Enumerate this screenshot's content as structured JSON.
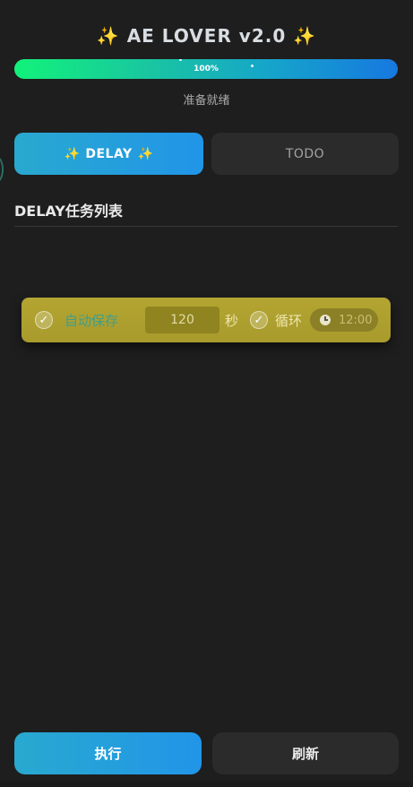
{
  "app": {
    "sparkle": "✨",
    "title": "AE LOVER v2.0"
  },
  "progress": {
    "value": 1.0,
    "label": "100%",
    "gradient": [
      "#12f27a",
      "#1678e0"
    ]
  },
  "status": {
    "text": "准备就绪"
  },
  "tabs": [
    {
      "label": "DELAY",
      "active": true
    },
    {
      "label": "TODO",
      "active": false
    }
  ],
  "section": {
    "title": "DELAY任务列表"
  },
  "task": {
    "autosave_label": "自动保存",
    "autosave_checked": true,
    "seconds_value": "120",
    "seconds_placeholder": "120",
    "seconds_unit": "秒",
    "loop_label": "循环",
    "loop_checked": true,
    "time": "12:00",
    "card_color": "#b4a532"
  },
  "actions": {
    "run_label": "执行",
    "refresh_label": "刷新"
  },
  "icons": {
    "check": "✓",
    "clock_icon": "clock-icon"
  },
  "colors": {
    "accent": "#2195e8",
    "background": "#1e1e1e"
  }
}
